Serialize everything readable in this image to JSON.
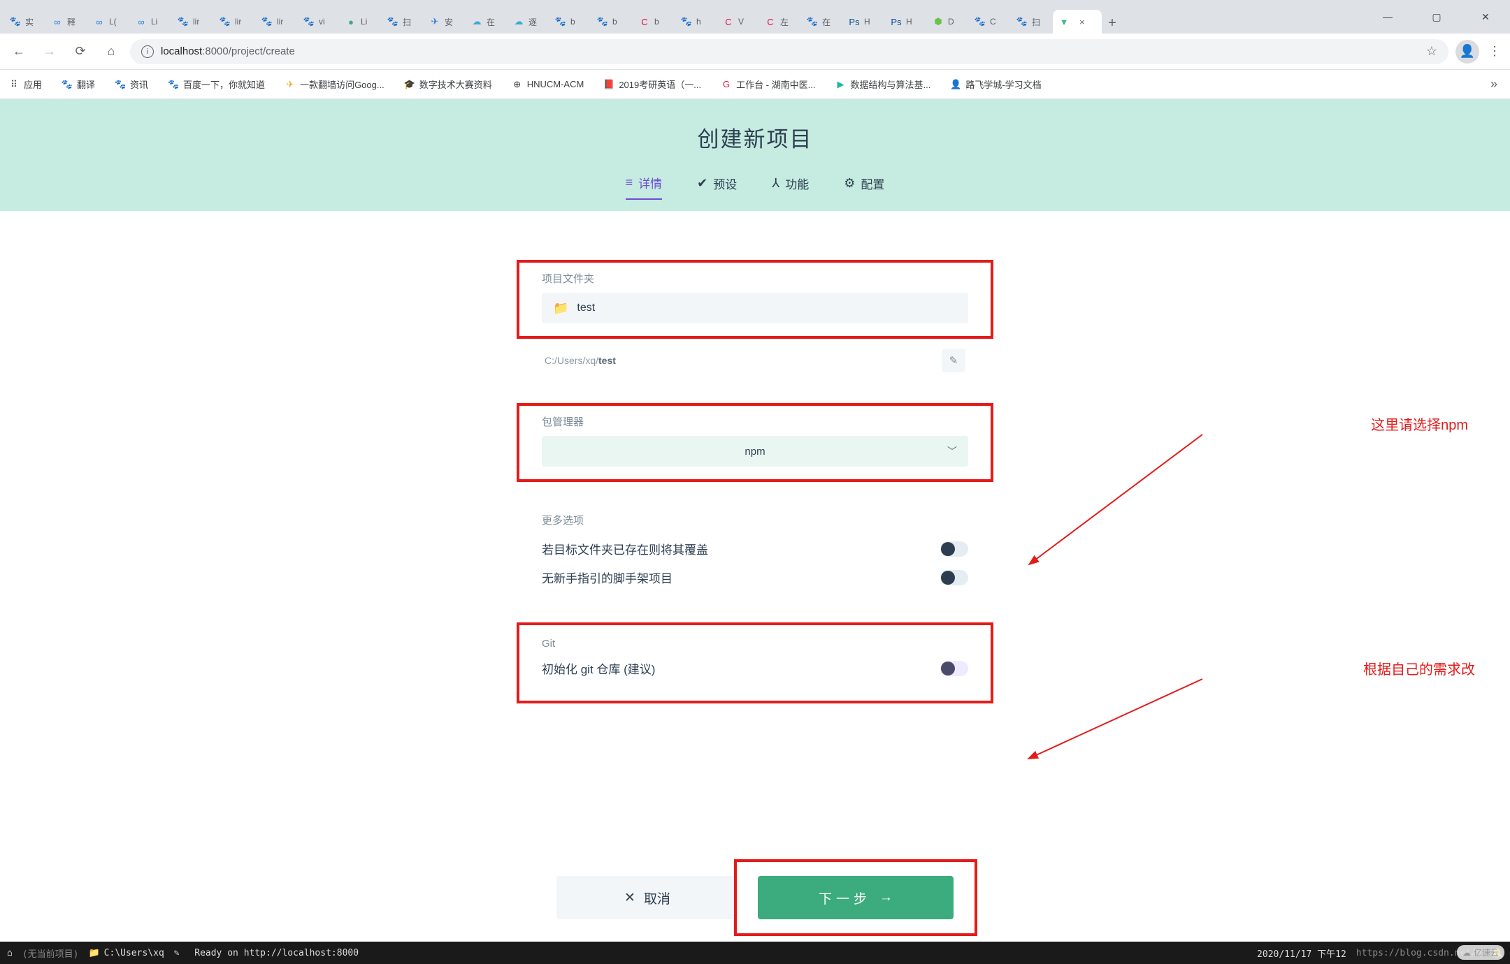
{
  "browser": {
    "tabs": [
      {
        "icon": "🐾",
        "cls": "fc-paw",
        "title": "实"
      },
      {
        "icon": "∞",
        "cls": "fc-blue",
        "title": "释"
      },
      {
        "icon": "∞",
        "cls": "fc-blue",
        "title": "L("
      },
      {
        "icon": "∞",
        "cls": "fc-blue",
        "title": "Li"
      },
      {
        "icon": "🐾",
        "cls": "fc-paw",
        "title": "lir"
      },
      {
        "icon": "🐾",
        "cls": "fc-paw",
        "title": "lir"
      },
      {
        "icon": "🐾",
        "cls": "fc-paw",
        "title": "lir"
      },
      {
        "icon": "🐾",
        "cls": "fc-paw",
        "title": "vi"
      },
      {
        "icon": "●",
        "cls": "fc-green",
        "title": "Li"
      },
      {
        "icon": "🐾",
        "cls": "fc-paw",
        "title": "扫"
      },
      {
        "icon": "✈",
        "cls": "fc-rocket",
        "title": "安"
      },
      {
        "icon": "☁",
        "cls": "fc-cloud",
        "title": "在"
      },
      {
        "icon": "☁",
        "cls": "fc-cloud",
        "title": "逐"
      },
      {
        "icon": "🐾",
        "cls": "fc-paw",
        "title": "b"
      },
      {
        "icon": "🐾",
        "cls": "fc-paw",
        "title": "b"
      },
      {
        "icon": "C",
        "cls": "fc-red",
        "title": "b"
      },
      {
        "icon": "🐾",
        "cls": "fc-paw",
        "title": "h"
      },
      {
        "icon": "C",
        "cls": "fc-red",
        "title": "V"
      },
      {
        "icon": "C",
        "cls": "fc-red",
        "title": "左"
      },
      {
        "icon": "🐾",
        "cls": "fc-paw",
        "title": "在"
      },
      {
        "icon": "Ps",
        "cls": "fc-ps",
        "title": "H"
      },
      {
        "icon": "Ps",
        "cls": "fc-ps",
        "title": "H"
      },
      {
        "icon": "⬢",
        "cls": "fc-node",
        "title": "D"
      },
      {
        "icon": "🐾",
        "cls": "fc-paw",
        "title": "C"
      },
      {
        "icon": "🐾",
        "cls": "fc-paw",
        "title": "扫"
      },
      {
        "icon": "▼",
        "cls": "fc-vue",
        "title": "",
        "active": true
      }
    ],
    "url_host": "localhost",
    "url_port": ":8000",
    "url_path": "/project/create",
    "bookmarks": [
      {
        "icon": "⠿",
        "cls": "",
        "label": "应用"
      },
      {
        "icon": "🐾",
        "cls": "fc-paw",
        "label": "翻译"
      },
      {
        "icon": "🐾",
        "cls": "fc-paw",
        "label": "资讯"
      },
      {
        "icon": "🐾",
        "cls": "fc-paw",
        "label": "百度一下，你就知道"
      },
      {
        "icon": "✈",
        "cls": "fc-orange",
        "label": "一款翻墙访问Goog..."
      },
      {
        "icon": "🎓",
        "cls": "fc-blue",
        "label": "数字技术大赛资料"
      },
      {
        "icon": "⊕",
        "cls": "fc-dark",
        "label": "HNUCM-ACM"
      },
      {
        "icon": "📕",
        "cls": "fc-red",
        "label": "2019考研英语（一..."
      },
      {
        "icon": "G",
        "cls": "fc-red",
        "label": "工作台 - 湖南中医..."
      },
      {
        "icon": "▶",
        "cls": "fc-teal",
        "label": "数据结构与算法基..."
      },
      {
        "icon": "👤",
        "cls": "fc-dark",
        "label": "路飞学城-学习文档"
      }
    ]
  },
  "page": {
    "title": "创建新项目",
    "tabs": [
      {
        "icon": "≡",
        "label": "详情",
        "active": true
      },
      {
        "icon": "✔",
        "label": "预设"
      },
      {
        "icon": "⅄",
        "label": "功能"
      },
      {
        "icon": "⚙",
        "label": "配置"
      }
    ],
    "folder": {
      "label": "项目文件夹",
      "value": "test",
      "path_prefix": "C:/Users/xq/",
      "path_bold": "test"
    },
    "package_manager": {
      "label": "包管理器",
      "value": "npm"
    },
    "more_options": {
      "label": "更多选项",
      "opt1": "若目标文件夹已存在则将其覆盖",
      "opt2": "无新手指引的脚手架项目"
    },
    "git": {
      "label": "Git",
      "text": "初始化 git 仓库 (建议)"
    },
    "buttons": {
      "cancel": "取消",
      "next": "下一步"
    }
  },
  "annotations": {
    "a1": "这里请选择npm",
    "a2": "根据自己的需求改"
  },
  "terminal": {
    "no_project": "(无当前项目)",
    "cwd": "C:\\Users\\xq",
    "msg": "Ready on http://localhost:8000",
    "time": "2020/11/17  下午12",
    "blog": "https://blog.csdn.net/q",
    "brand": "亿速云"
  }
}
